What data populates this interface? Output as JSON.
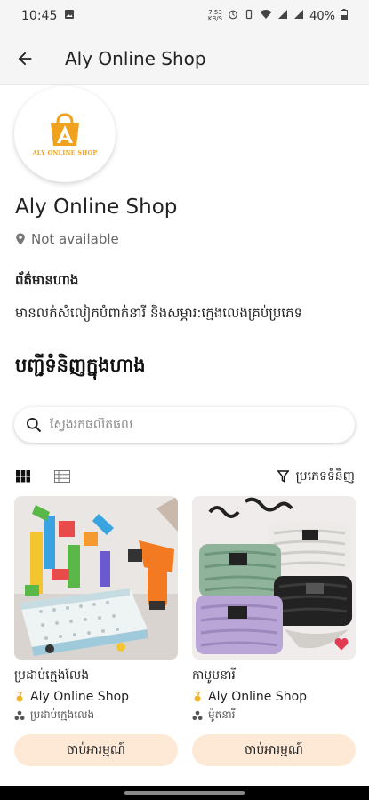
{
  "status_bar": {
    "time": "10:45",
    "battery": "40%",
    "data_speed": "7.53\nKB/S"
  },
  "app_bar": {
    "title": "Aly Online Shop"
  },
  "shop": {
    "logo_text": "ALY ONLINE SHOP",
    "name": "Aly Online Shop",
    "location": "Not available",
    "info_title": "ព័ត៌មានហាង",
    "info_desc": "មានលក់សំលៀកបំពាក់នារី និងសម្ភារ:ក្មេងលេងគ្រប់ប្រភេទ"
  },
  "products_section": {
    "title": "បញ្ជីទំនិញក្នុងហាង",
    "search_placeholder": "ស្វែងរកផលិតផល",
    "filter_label": "ប្រភេទទំនិញ"
  },
  "products": [
    {
      "name": "ប្រដាប់ក្មេងលែង",
      "shop": "Aly Online Shop",
      "category": "ប្រដាប់ក្មេងលេង",
      "button": "ចាប់អារម្មណ៍"
    },
    {
      "name": "កាបូបនារី",
      "shop": "Aly Online Shop",
      "category": "ម៉ូតនារី",
      "button": "ចាប់អារម្មណ៍"
    }
  ],
  "colors": {
    "accent_orange": "#f0a21e",
    "button_bg": "#fde9d6",
    "heart": "#e53950"
  }
}
